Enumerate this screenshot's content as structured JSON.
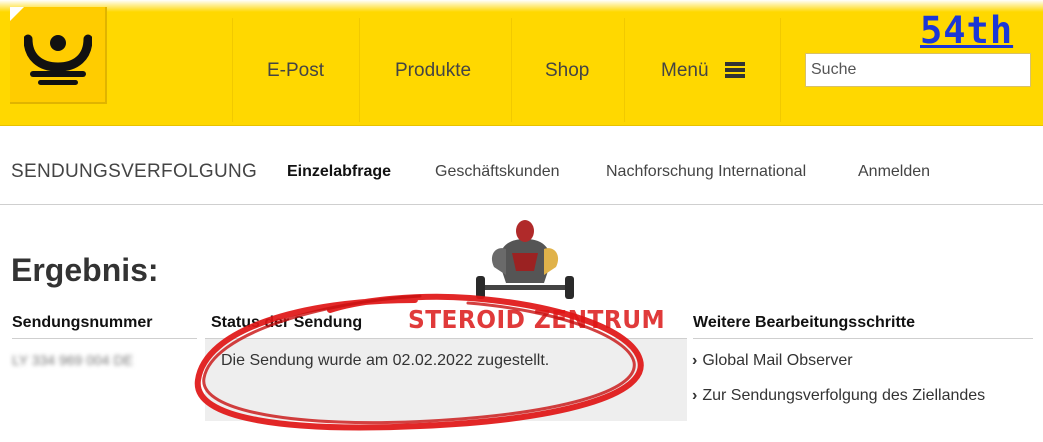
{
  "header": {
    "nav": [
      "E-Post",
      "Produkte",
      "Shop",
      "Menü"
    ],
    "search_placeholder": "Suche",
    "badge": "54th"
  },
  "subnav": {
    "title": "SENDUNGSVERFOLGUNG",
    "items": [
      "Einzelabfrage",
      "Geschäftskunden",
      "Nachforschung International",
      "Anmelden"
    ],
    "active": "Einzelabfrage"
  },
  "result": {
    "title": "Ergebnis:",
    "columns": [
      "Sendungsnummer",
      "Status der Sendung",
      "Weitere Bearbeitungsschritte"
    ],
    "tracking_number": "LY 334 969 004 DE",
    "status": "Die Sendung wurde am 02.02.2022 zugestellt.",
    "links": [
      "Global Mail Observer",
      "Zur Sendungsverfolgung des Ziellandes"
    ]
  },
  "watermark": {
    "text": "STEROID ZENTRUM"
  },
  "colors": {
    "header_yellow": "#ffd800",
    "logo_yellow": "#ffcc00",
    "badge_blue": "#1b37d6",
    "annotation_red": "#e01515"
  }
}
